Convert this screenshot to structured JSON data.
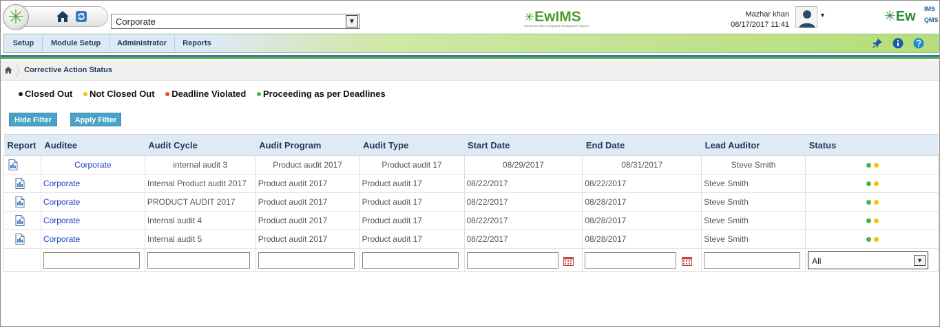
{
  "header": {
    "org_selected": "Corporate",
    "brand_center": "EwIMS",
    "brand_center_tagline": "Enterprise-wide Integrated Management System",
    "brand_right": "Ew",
    "brand_right_top": "IMS",
    "brand_right_bottom": "QMS",
    "user_name": "Mazhar khan",
    "user_datetime": "08/17/2017 11:41"
  },
  "menu": {
    "items": [
      "Setup",
      "Module Setup",
      "Administrator",
      "Reports"
    ]
  },
  "breadcrumb": {
    "title": "Corrective Action Status"
  },
  "legend": [
    {
      "label": "Closed Out",
      "color": "#1a1a1a"
    },
    {
      "label": "Not Closed Out",
      "color": "#f2c500"
    },
    {
      "label": "Deadline Violated",
      "color": "#e8501f"
    },
    {
      "label": "Proceeding as per Deadlines",
      "color": "#4caf50"
    }
  ],
  "buttons": {
    "hide_filter": "Hide Filter",
    "apply_filter": "Apply Filter"
  },
  "table": {
    "columns": [
      "Report",
      "Auditee",
      "Audit Cycle",
      "Audit Program",
      "Audit Type",
      "Start Date",
      "End Date",
      "Lead Auditor",
      "Status"
    ],
    "rows": [
      [
        "Corporate",
        "internal audit 3",
        "Product audit 2017",
        "Product audit 17",
        "08/29/2017",
        "08/31/2017",
        "Steve Smith"
      ],
      [
        "Corporate",
        "Internal Product audit 2017",
        "Product audit 2017",
        "Product audit 17",
        "08/22/2017",
        "08/22/2017",
        "Steve Smith"
      ],
      [
        "Corporate",
        "PRODUCT AUDIT 2017",
        "Product audit 2017",
        "Product audit 17",
        "08/22/2017",
        "08/28/2017",
        "Steve Smith"
      ],
      [
        "Corporate",
        "Internal audit 4",
        "Product audit 2017",
        "Product audit 17",
        "08/22/2017",
        "08/28/2017",
        "Steve Smith"
      ],
      [
        "Corporate",
        "Internal audit 5",
        "Product audit 2017",
        "Product audit 17",
        "08/22/2017",
        "08/28/2017",
        "Steve Smith"
      ]
    ],
    "status_colors": [
      "#4caf50",
      "#f2c500"
    ],
    "status_filter_value": "All"
  }
}
